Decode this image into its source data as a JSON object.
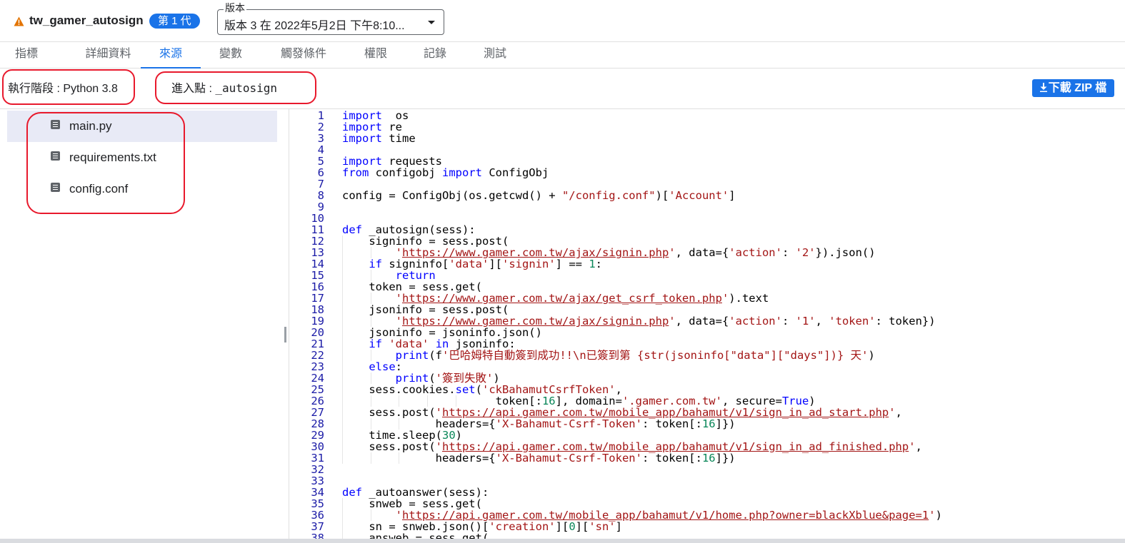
{
  "header": {
    "warning_icon": "warning-triangle-icon",
    "function_name": "tw_gamer_autosign",
    "generation_badge": "第 1 代",
    "version_label": "版本",
    "version_value": "版本 3 在 2022年5月2日 下午8:10..."
  },
  "tabs": [
    {
      "label": "指標"
    },
    {
      "label": "詳細資料"
    },
    {
      "label": "來源",
      "active": true
    },
    {
      "label": "變數"
    },
    {
      "label": "觸發條件"
    },
    {
      "label": "權限"
    },
    {
      "label": "記錄"
    },
    {
      "label": "測試"
    }
  ],
  "info": {
    "runtime_label": "執行階段 : Python 3.8",
    "entry_label": "進入點 : ",
    "entry_value": "_autosign",
    "download_label": "下載 ZIP 檔"
  },
  "files": [
    {
      "name": "main.py",
      "selected": true
    },
    {
      "name": "requirements.txt"
    },
    {
      "name": "config.conf"
    }
  ],
  "colors": {
    "accent": "#1a73e8",
    "annotation": "#e8192c",
    "keyword": "#0000ff",
    "string": "#a31515"
  },
  "code_lines": [
    [
      [
        "kw",
        "import"
      ],
      [
        "",
        "  os"
      ]
    ],
    [
      [
        "kw",
        "import"
      ],
      [
        "",
        " re"
      ]
    ],
    [
      [
        "kw",
        "import"
      ],
      [
        "",
        " time"
      ]
    ],
    [],
    [
      [
        "kw",
        "import"
      ],
      [
        "",
        " requests"
      ]
    ],
    [
      [
        "kw",
        "from"
      ],
      [
        "",
        " configobj "
      ],
      [
        "kw",
        "import"
      ],
      [
        "",
        " ConfigObj"
      ]
    ],
    [],
    [
      [
        "",
        "config = ConfigObj(os.getcwd() + "
      ],
      [
        "str",
        "\"/config.conf\""
      ],
      [
        "",
        ")["
      ],
      [
        "str",
        "'Account'"
      ],
      [
        "",
        "]"
      ]
    ],
    [],
    [],
    [
      [
        "kw",
        "def"
      ],
      [
        "",
        " _autosign(sess):"
      ]
    ],
    [
      [
        "",
        "    signinfo = sess.post("
      ]
    ],
    [
      [
        "",
        "        "
      ],
      [
        "str",
        "'"
      ],
      [
        "url",
        "https://www.gamer.com.tw/ajax/signin.php"
      ],
      [
        "str",
        "'"
      ],
      [
        "",
        ", data={"
      ],
      [
        "str",
        "'action'"
      ],
      [
        "",
        ": "
      ],
      [
        "str",
        "'2'"
      ],
      [
        "",
        "}).json()"
      ]
    ],
    [
      [
        "",
        "    "
      ],
      [
        "kw",
        "if"
      ],
      [
        "",
        " signinfo["
      ],
      [
        "str",
        "'data'"
      ],
      [
        "",
        "]["
      ],
      [
        "str",
        "'signin'"
      ],
      [
        "",
        "] == "
      ],
      [
        "num",
        "1"
      ],
      [
        "",
        ":"
      ]
    ],
    [
      [
        "",
        "        "
      ],
      [
        "kw",
        "return"
      ]
    ],
    [
      [
        "",
        "    token = sess.get("
      ]
    ],
    [
      [
        "",
        "        "
      ],
      [
        "str",
        "'"
      ],
      [
        "url",
        "https://www.gamer.com.tw/ajax/get_csrf_token.php"
      ],
      [
        "str",
        "'"
      ],
      [
        "",
        ").text"
      ]
    ],
    [
      [
        "",
        "    jsoninfo = sess.post("
      ]
    ],
    [
      [
        "",
        "        "
      ],
      [
        "str",
        "'"
      ],
      [
        "url",
        "https://www.gamer.com.tw/ajax/signin.php"
      ],
      [
        "str",
        "'"
      ],
      [
        "",
        ", data={"
      ],
      [
        "str",
        "'action'"
      ],
      [
        "",
        ": "
      ],
      [
        "str",
        "'1'"
      ],
      [
        "",
        ", "
      ],
      [
        "str",
        "'token'"
      ],
      [
        "",
        ": token})"
      ]
    ],
    [
      [
        "",
        "    jsoninfo = jsoninfo.json()"
      ]
    ],
    [
      [
        "",
        "    "
      ],
      [
        "kw",
        "if"
      ],
      [
        "",
        " "
      ],
      [
        "str",
        "'data'"
      ],
      [
        "",
        " "
      ],
      [
        "kw",
        "in"
      ],
      [
        "",
        " jsoninfo:"
      ]
    ],
    [
      [
        "",
        "        "
      ],
      [
        "kw",
        "print"
      ],
      [
        "",
        "(f"
      ],
      [
        "str",
        "'巴哈姆特自動簽到成功!!\\n已簽到第 {str(jsoninfo[\"data\"][\"days\"])} 天'"
      ],
      [
        "",
        ")"
      ]
    ],
    [
      [
        "",
        "    "
      ],
      [
        "kw",
        "else"
      ],
      [
        "",
        ":"
      ]
    ],
    [
      [
        "",
        "        "
      ],
      [
        "kw",
        "print"
      ],
      [
        "",
        "("
      ],
      [
        "str",
        "'簽到失敗'"
      ],
      [
        "",
        ")"
      ]
    ],
    [
      [
        "",
        "    sess.cookies."
      ],
      [
        "kw",
        "set"
      ],
      [
        "",
        "("
      ],
      [
        "str",
        "'ckBahamutCsrfToken'"
      ],
      [
        "",
        ","
      ]
    ],
    [
      [
        "",
        "                       token[:"
      ],
      [
        "num",
        "16"
      ],
      [
        "",
        "], domain="
      ],
      [
        "str",
        "'.gamer.com.tw'"
      ],
      [
        "",
        ", secure="
      ],
      [
        "kw",
        "True"
      ],
      [
        "",
        ")"
      ]
    ],
    [
      [
        "",
        "    sess.post("
      ],
      [
        "str",
        "'"
      ],
      [
        "url",
        "https://api.gamer.com.tw/mobile_app/bahamut/v1/sign_in_ad_start.php"
      ],
      [
        "str",
        "'"
      ],
      [
        "",
        ","
      ]
    ],
    [
      [
        "",
        "              headers={"
      ],
      [
        "str",
        "'X-Bahamut-Csrf-Token'"
      ],
      [
        "",
        ": token[:"
      ],
      [
        "num",
        "16"
      ],
      [
        "",
        "]})"
      ]
    ],
    [
      [
        "",
        "    time.sleep("
      ],
      [
        "num",
        "30"
      ],
      [
        "",
        ")"
      ]
    ],
    [
      [
        "",
        "    sess.post("
      ],
      [
        "str",
        "'"
      ],
      [
        "url",
        "https://api.gamer.com.tw/mobile_app/bahamut/v1/sign_in_ad_finished.php"
      ],
      [
        "str",
        "'"
      ],
      [
        "",
        ","
      ]
    ],
    [
      [
        "",
        "              headers={"
      ],
      [
        "str",
        "'X-Bahamut-Csrf-Token'"
      ],
      [
        "",
        ": token[:"
      ],
      [
        "num",
        "16"
      ],
      [
        "",
        "]})"
      ]
    ],
    [],
    [],
    [
      [
        "kw",
        "def"
      ],
      [
        "",
        " _autoanswer(sess):"
      ]
    ],
    [
      [
        "",
        "    snweb = sess.get("
      ]
    ],
    [
      [
        "",
        "        "
      ],
      [
        "str",
        "'"
      ],
      [
        "url",
        "https://api.gamer.com.tw/mobile_app/bahamut/v1/home.php?owner=blackXblue&page=1"
      ],
      [
        "str",
        "'"
      ],
      [
        "",
        ")"
      ]
    ],
    [
      [
        "",
        "    sn = snweb.json()["
      ],
      [
        "str",
        "'creation'"
      ],
      [
        "",
        "]["
      ],
      [
        "num",
        "0"
      ],
      [
        "",
        "]["
      ],
      [
        "str",
        "'sn'"
      ],
      [
        "",
        "]"
      ]
    ],
    [
      [
        "",
        "    answeb = sess.get("
      ]
    ]
  ]
}
